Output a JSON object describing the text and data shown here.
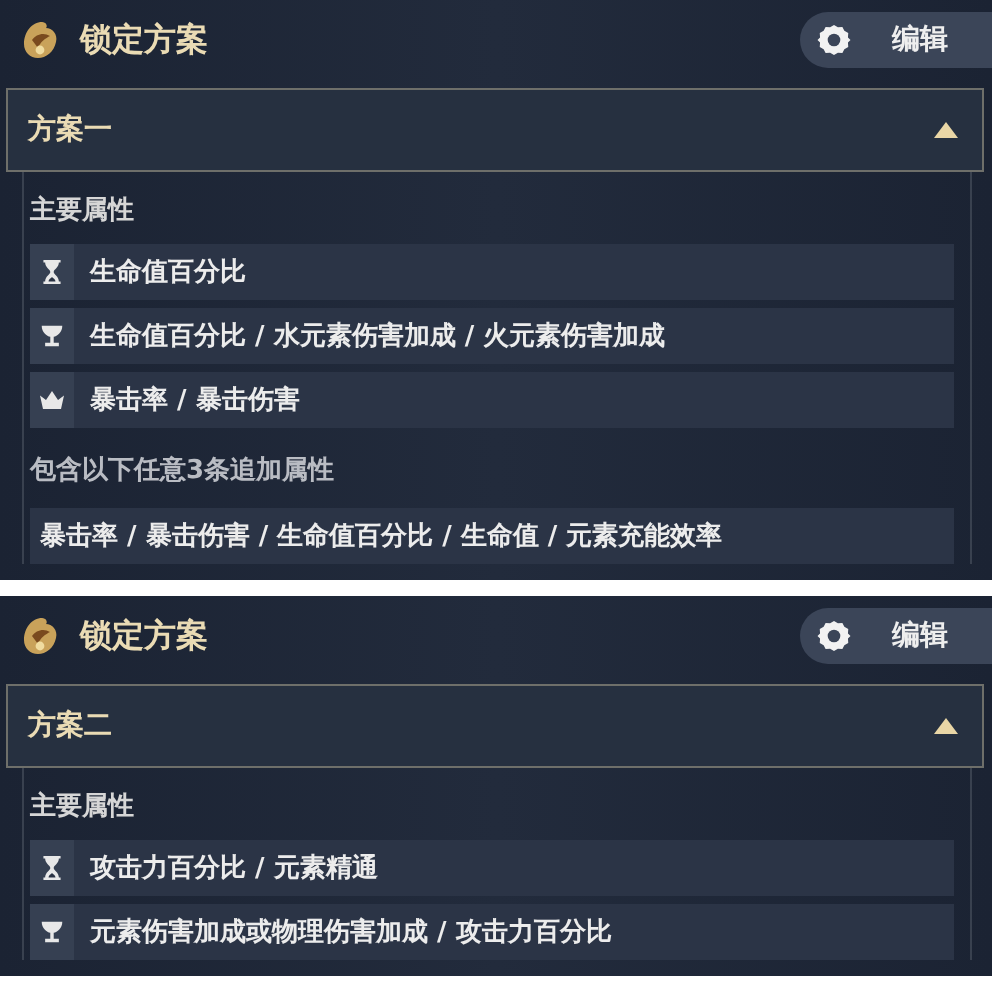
{
  "panels": [
    {
      "title": "锁定方案",
      "edit_label": "编辑",
      "scheme": {
        "name": "方案一",
        "expanded": true
      },
      "main_label": "主要属性",
      "main_stats": [
        {
          "kind": "sands",
          "text": "生命值百分比"
        },
        {
          "kind": "goblet",
          "text": "生命值百分比 / 水元素伤害加成 / 火元素伤害加成"
        },
        {
          "kind": "circlet",
          "text": "暴击率 / 暴击伤害"
        }
      ],
      "extra_label": "包含以下任意3条追加属性",
      "extra_stats": [
        "暴击率 / 暴击伤害 / 生命值百分比 / 生命值 / 元素充能效率"
      ]
    },
    {
      "title": "锁定方案",
      "edit_label": "编辑",
      "scheme": {
        "name": "方案二",
        "expanded": true
      },
      "main_label": "主要属性",
      "main_stats": [
        {
          "kind": "sands",
          "text": "攻击力百分比 / 元素精通"
        },
        {
          "kind": "goblet",
          "text": "元素伤害加成或物理伤害加成 / 攻击力百分比"
        }
      ]
    }
  ]
}
